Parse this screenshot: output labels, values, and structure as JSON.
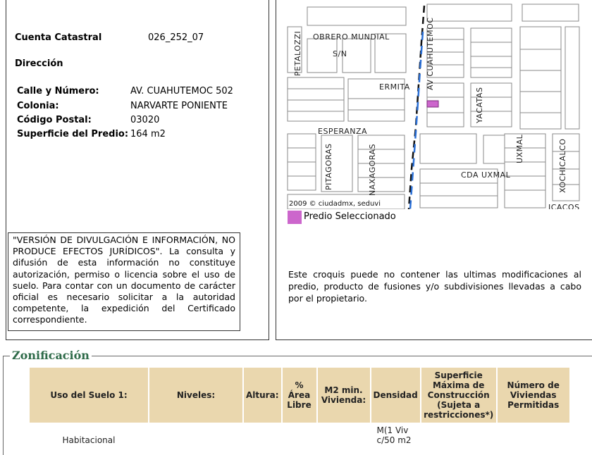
{
  "property": {
    "cuenta_label": "Cuenta Catastral",
    "cuenta_value": "026_252_07",
    "direccion_label": "Dirección",
    "calle_label": "Calle y Número:",
    "calle_value": "AV. CUAHUTEMOC 502",
    "colonia_label": "Colonia:",
    "colonia_value": "NARVARTE PONIENTE",
    "cp_label": "Código Postal:",
    "cp_value": "03020",
    "superficie_label": "Superficie del Predio:",
    "superficie_value": "164 m2"
  },
  "disclaimer": "\"VERSIÓN DE DIVULGACIÓN E INFORMACIÓN, NO PRODUCE EFECTOS JURÍDICOS\". La consulta y difusión de esta información no constituye autorización, permiso o licencia sobre el uso de suelo. Para contar con un documento de carácter oficial es necesario solicitar a la autoridad competente, la expedición del Certificado correspondiente.",
  "map": {
    "streets": {
      "obrero_mundial": "OBRERO MUNDIAL",
      "sn": "S/N",
      "petalozzi": "PETALOZZI",
      "av_cuahutemoc": "AV CUAHUTEMOC",
      "ermita": "ERMITA",
      "yacatas": "YACATAS",
      "esperanza": "ESPERANZA",
      "pitagoras": "PITAGORAS",
      "naxagoras": "NAXAGORAS",
      "cda_uxmal": "CDA UXMAL",
      "uxmal": "UXMAL",
      "xochicalco": "XOCHICALCO",
      "icacos": "ICACOS"
    },
    "copyright": "2009 © ciudadmx, seduvi",
    "selected_color": "#cc66cc"
  },
  "legend_label": "Predio Seleccionado",
  "map_note": "Este croquis puede no contener las ultimas modificaciones al predio, producto de fusiones y/o subdivisiones llevadas a cabo por el propietario.",
  "zonificacion": {
    "title": "Zonificación",
    "headers": [
      "Uso del Suelo 1:",
      "Niveles:",
      "Altura:",
      "% Área Libre",
      "M2 min. Vivienda:",
      "Densidad",
      "Superficie Máxima de Construcción (Sujeta a restricciones*)",
      "Número de Viviendas Permitidas"
    ],
    "row": {
      "uso": "Habitacional",
      "densidad": "M(1 Viv c/50 m2"
    }
  }
}
